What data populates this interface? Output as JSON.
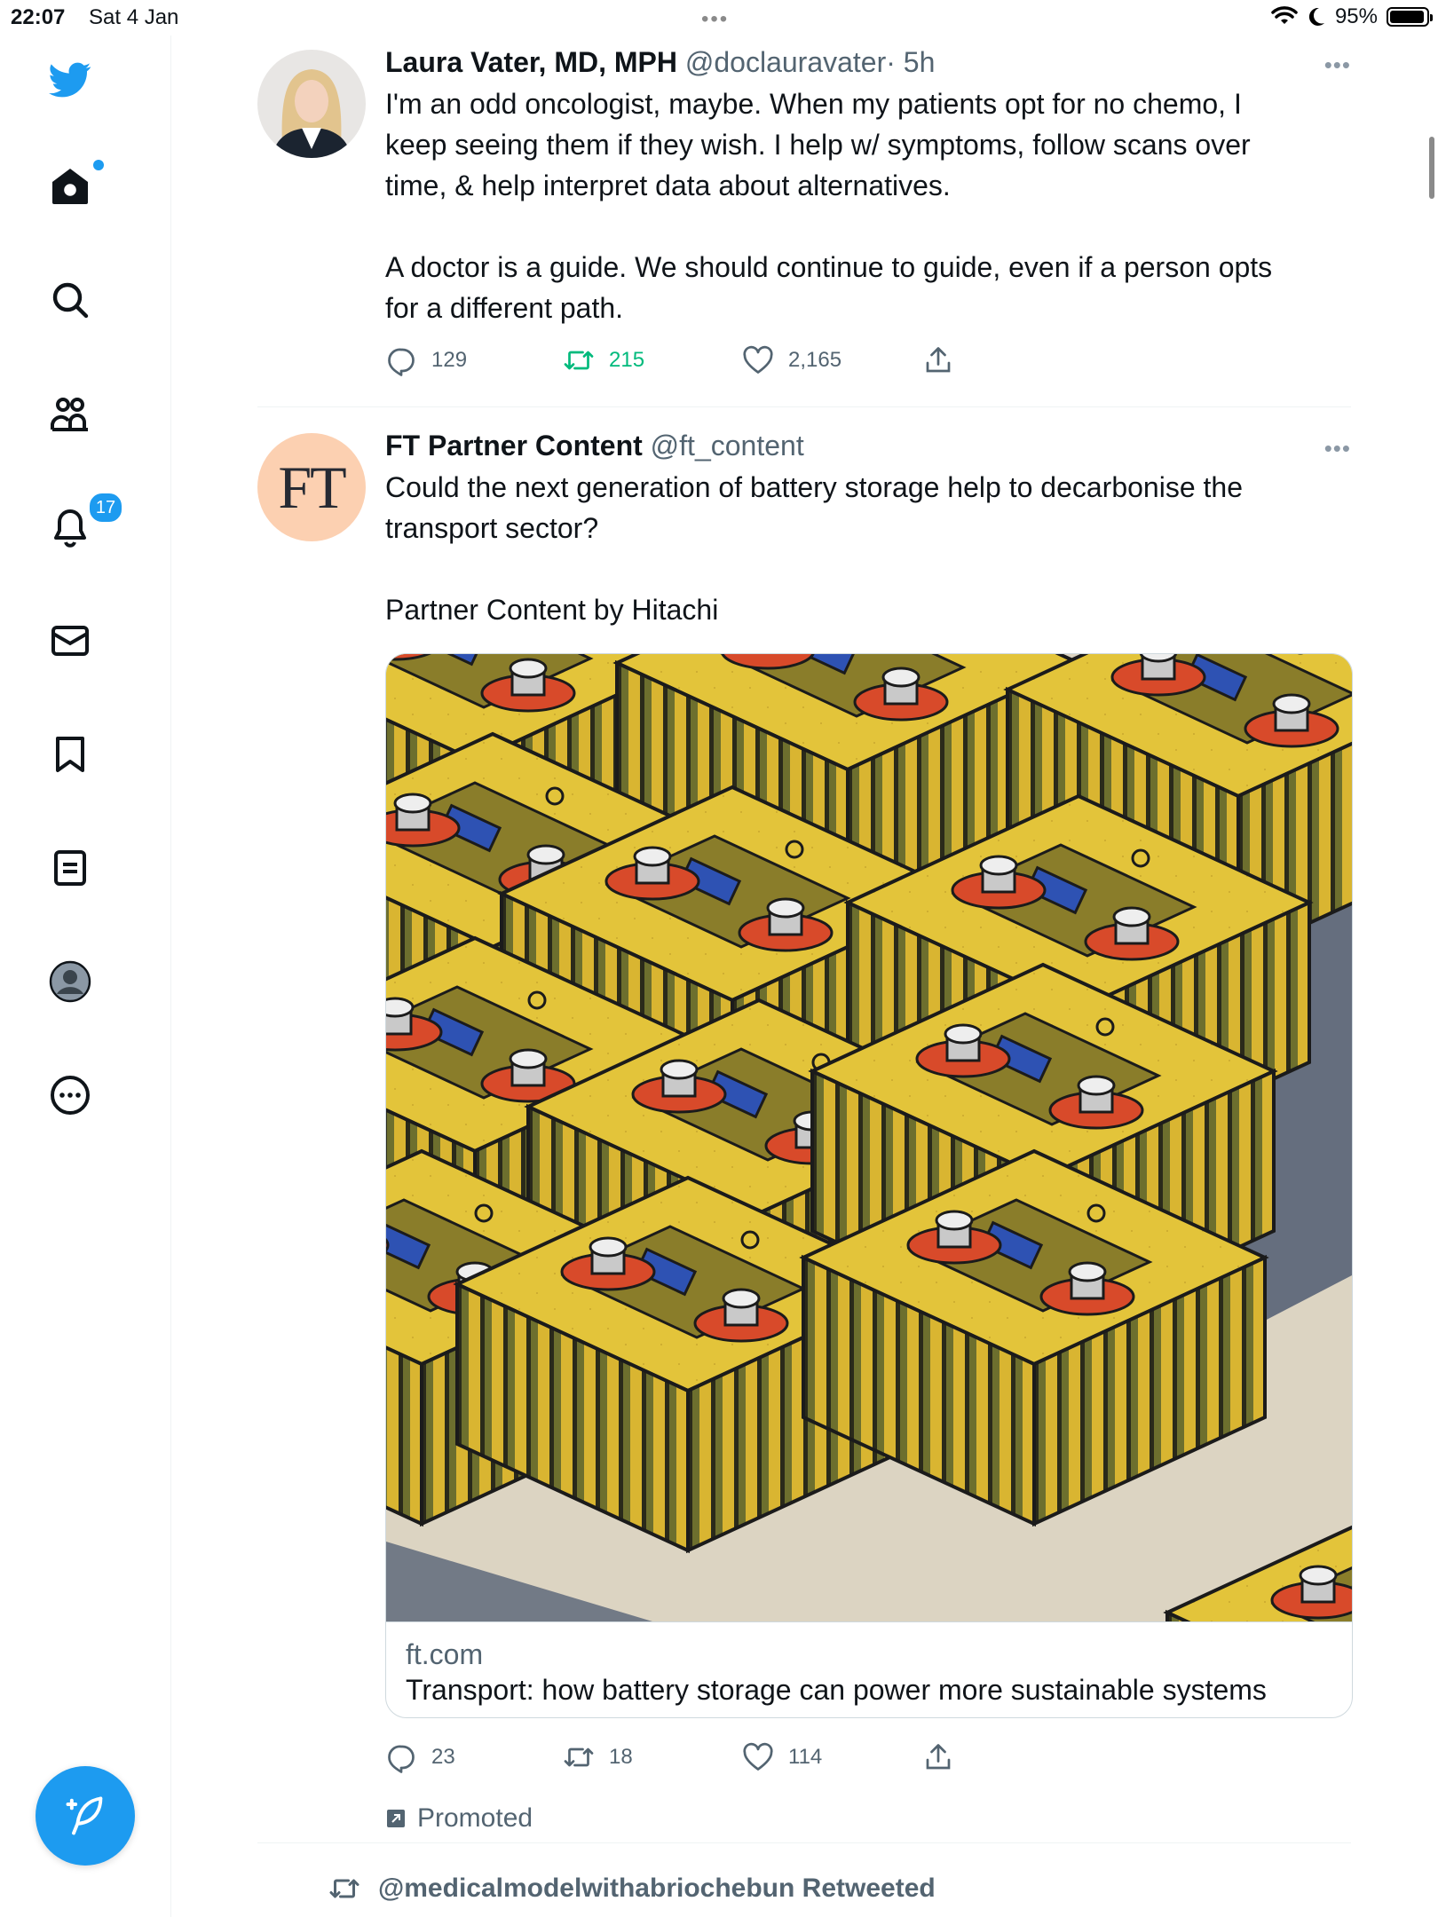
{
  "status_bar": {
    "time": "22:07",
    "date": "Sat 4 Jan",
    "dots": "•••",
    "battery": "95%"
  },
  "sidebar": {
    "notifications_badge": "17"
  },
  "tweets": [
    {
      "name": "Laura Vater, MD, MPH",
      "handle": "@doclauravater",
      "time": "· 5h",
      "text_lines": [
        "I'm an odd oncologist, maybe. When my patients opt for no chemo, I",
        "keep seeing them if they wish. I help w/ symptoms, follow scans over",
        "time, & help interpret data about alternatives.",
        "",
        "A doctor is a guide. We should continue to guide, even if a person opts",
        "for a different path."
      ],
      "replies": "129",
      "retweets": "215",
      "likes": "2,165"
    },
    {
      "name": "FT Partner Content",
      "handle": "@ft_content",
      "avatar_text": "FT",
      "text_lines": [
        "Could the next generation of battery storage help to decarbonise the",
        "transport sector?",
        "",
        "Partner Content by Hitachi"
      ],
      "card": {
        "domain": "ft.com",
        "title": "Transport: how battery storage can power more sustainable systems"
      },
      "replies": "23",
      "retweets": "18",
      "likes": "114",
      "promoted_label": "Promoted"
    }
  ],
  "retweet_context": "@medicalmodelwithabriochebun Retweeted",
  "colors": {
    "accent": "#1d9bf0",
    "retweet_green": "#00ba7c",
    "muted": "#536471"
  }
}
